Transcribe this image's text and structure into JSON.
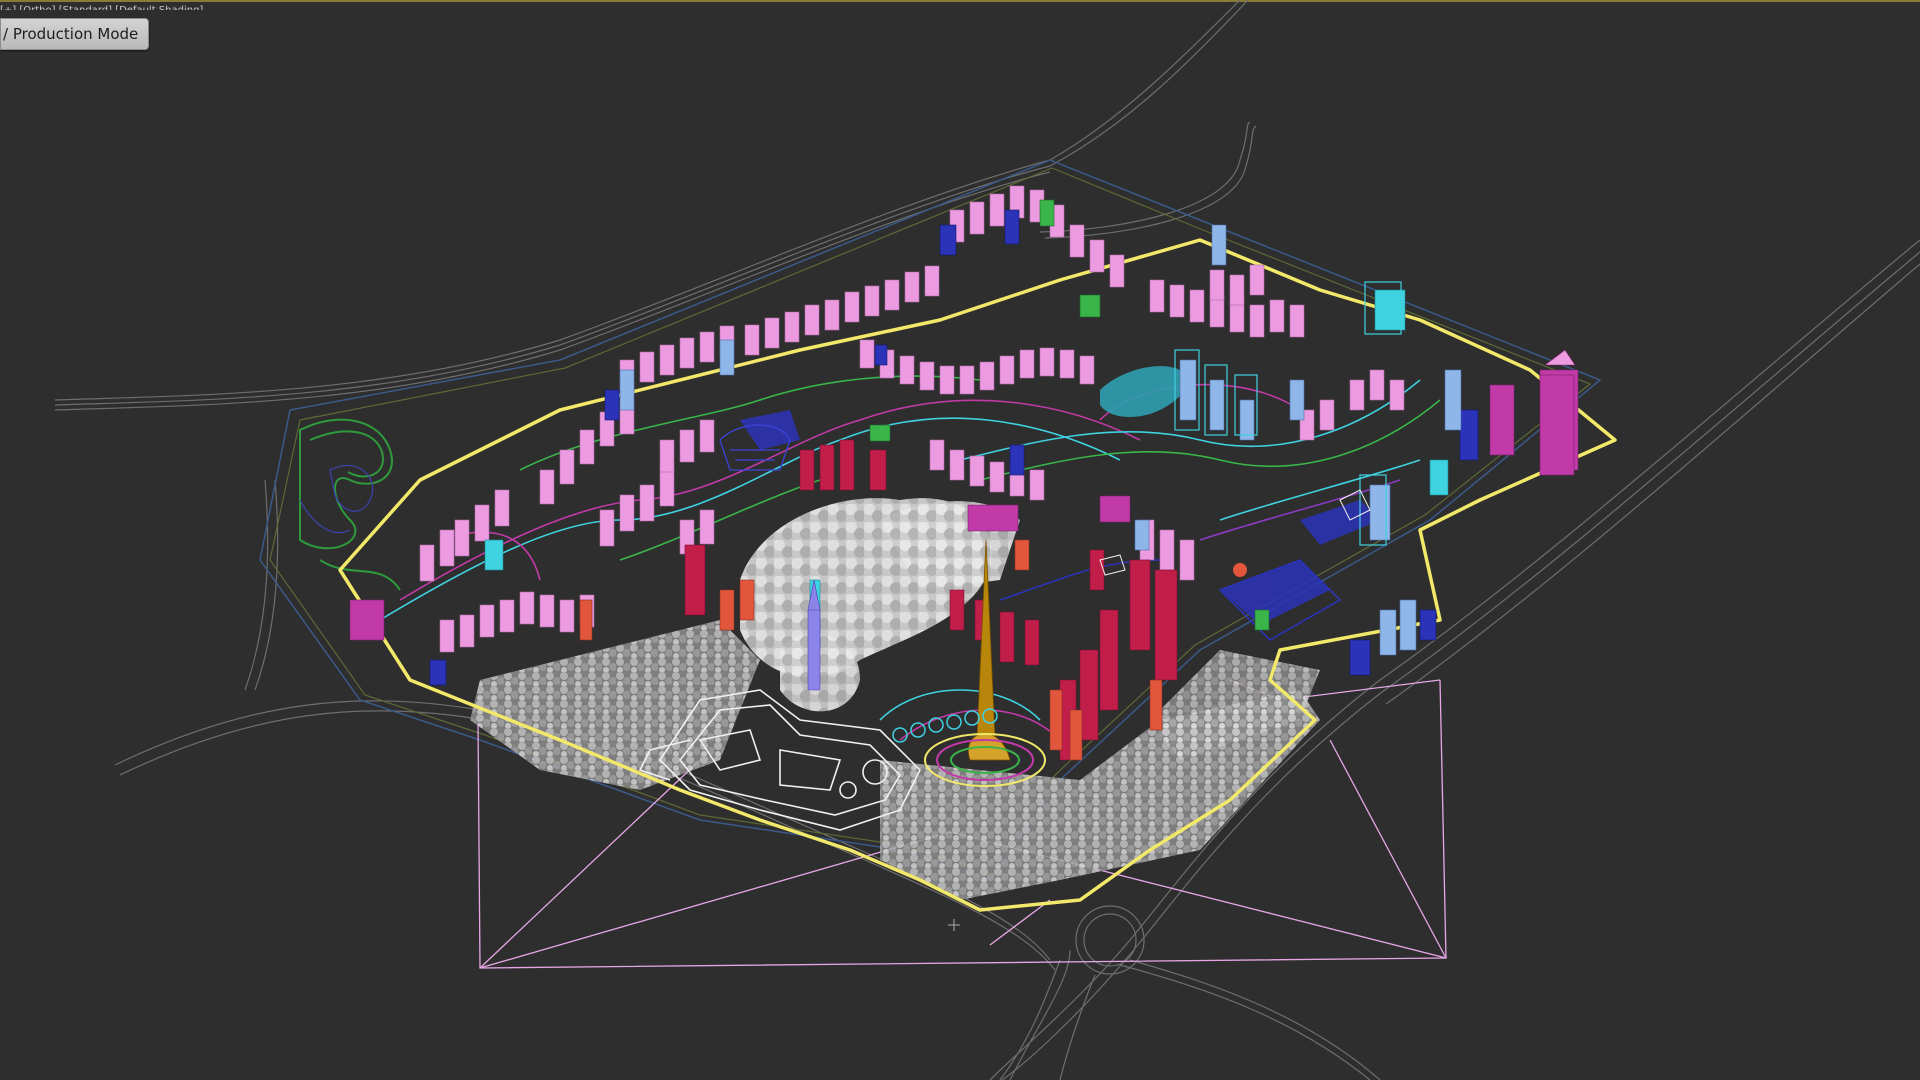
{
  "viewport": {
    "label": "[+] [Ortho] [Standard] [Default Shading]",
    "mode_badge": "/ Production Mode",
    "colors": {
      "background": "#2e2e2e",
      "site_boundary": "#f2e86a",
      "camera_frustum": "#e6a6e6",
      "roads": "#7b7b7b",
      "residential_towers": "#ec9be0",
      "tall_tower": "#b8860b",
      "trees": "#bdbdbd",
      "accent_magenta": "#c23aa8",
      "accent_crimson": "#c21e4a",
      "accent_cyan": "#3fd2e0",
      "accent_blue": "#2b33b8"
    },
    "icons": [
      "camera-frustum-icon",
      "camera-target-icon"
    ]
  }
}
